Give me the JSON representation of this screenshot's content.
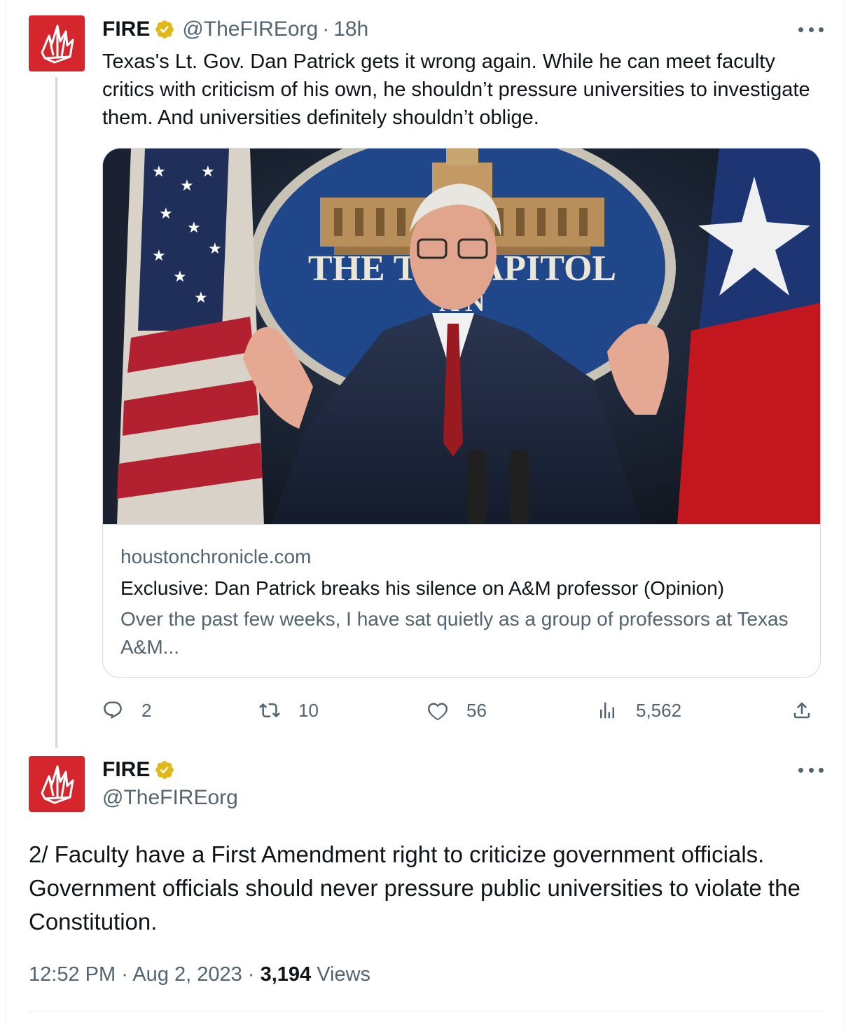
{
  "colors": {
    "brand_red": "#d6262d",
    "text_primary": "#0f1419",
    "text_secondary": "#536471",
    "verified_gold": "#e2b719",
    "border": "#cfd9de"
  },
  "tweet1": {
    "author_name": "FIRE",
    "author_handle": "@TheFIREorg",
    "separator": "·",
    "time": "18h",
    "text": "Texas's Lt. Gov. Dan Patrick gets it wrong again. While he can meet faculty critics with criticism of his own, he shouldn’t pressure universities to investigate them.  And universities definitely shouldn’t oblige.",
    "card": {
      "domain": "houstonchronicle.com",
      "title": "Exclusive: Dan Patrick breaks his silence on A&M professor (Opinion)",
      "description": "Over the past few weeks, I have sat quietly as a group of professors at Texas A&M...",
      "image_seal_text": "THE TE   CAPITOL",
      "image_seal_subtext": "A   N"
    },
    "actions": {
      "replies": "2",
      "retweets": "10",
      "likes": "56",
      "views": "5,562"
    }
  },
  "tweet2": {
    "author_name": "FIRE",
    "author_handle": "@TheFIREorg",
    "text": "2/ Faculty have a First Amendment right to criticize government officials. Government officials should never pressure public universities to violate the Constitution.",
    "time": "12:52 PM",
    "separator": "·",
    "date": "Aug 2, 2023",
    "views_count": "3,194",
    "views_label": "Views"
  }
}
